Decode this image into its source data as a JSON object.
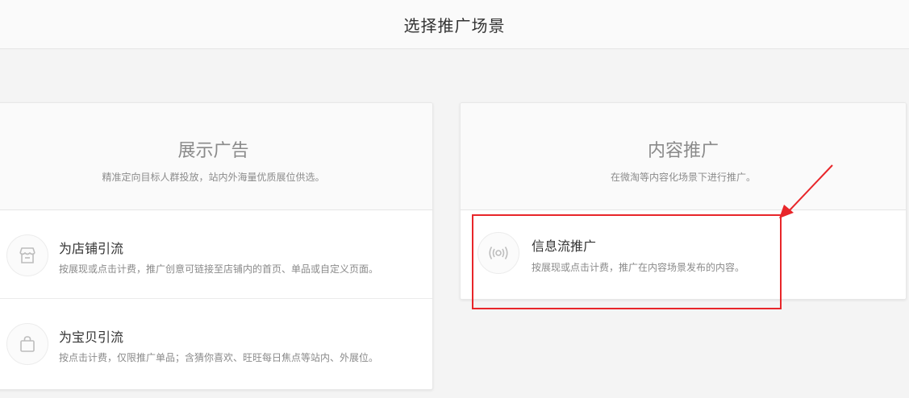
{
  "header": {
    "title": "选择推广场景"
  },
  "cards": [
    {
      "title": "展示广告",
      "desc": "精准定向目标人群投放，站内外海量优质展位供选。",
      "options": [
        {
          "icon": "store-icon",
          "title": "为店铺引流",
          "desc": "按展现或点击计费，推广创意可链接至店铺内的首页、单品或自定义页面。"
        },
        {
          "icon": "bag-icon",
          "title": "为宝贝引流",
          "desc": "按点击计费，仅限推广单品；含猜你喜欢、旺旺每日焦点等站内、外展位。"
        }
      ]
    },
    {
      "title": "内容推广",
      "desc": "在微淘等内容化场景下进行推广。",
      "options": [
        {
          "icon": "broadcast-icon",
          "title": "信息流推广",
          "desc": "按展现或点击计费，推广在内容场景发布的内容。"
        }
      ]
    }
  ],
  "colors": {
    "annotation": "#e8262a",
    "background": "#f4f4f4"
  }
}
